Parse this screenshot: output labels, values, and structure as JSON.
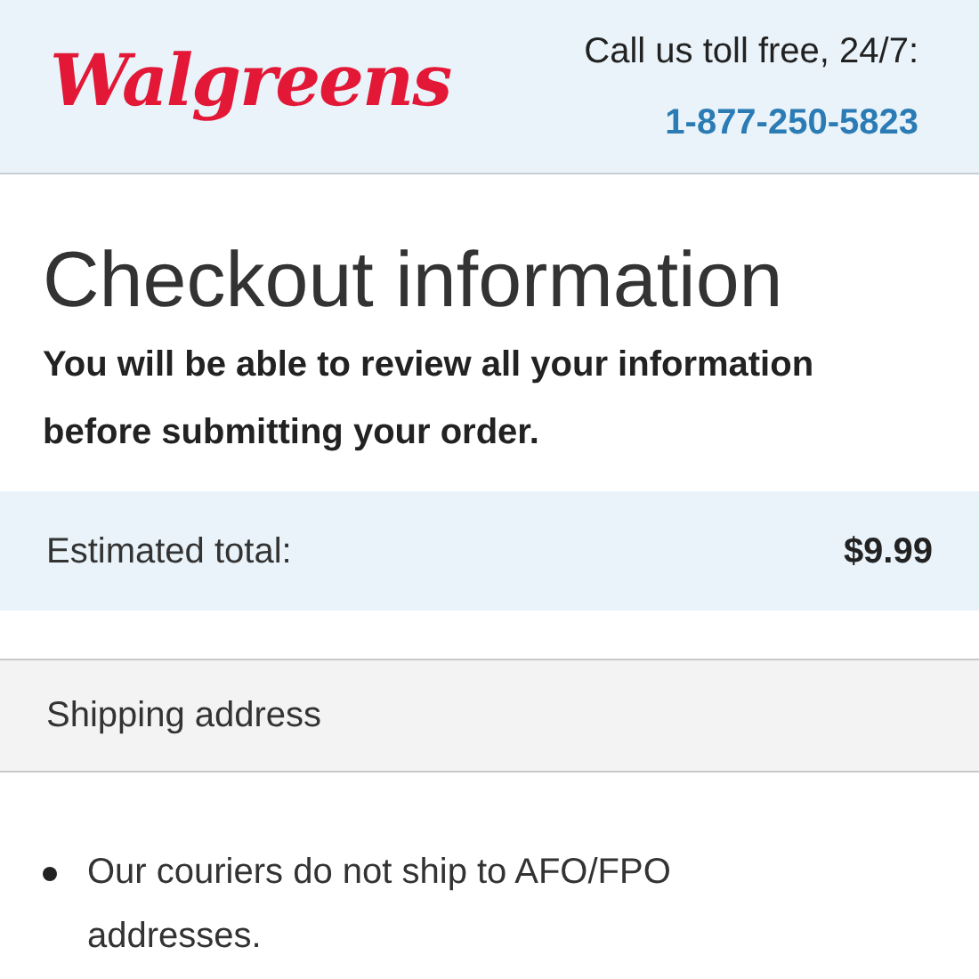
{
  "header": {
    "logo": "Walgreens",
    "call_label": "Call us toll free, 24/7:",
    "phone": "1-877-250-5823"
  },
  "title": "Checkout information",
  "subtitle": "You will be able to review all your information before submitting your order.",
  "estimate": {
    "label": "Estimated total:",
    "amount": "$9.99"
  },
  "section": {
    "title": "Shipping address"
  },
  "notes": [
    "Our couriers do not ship to AFO/FPO addresses."
  ]
}
